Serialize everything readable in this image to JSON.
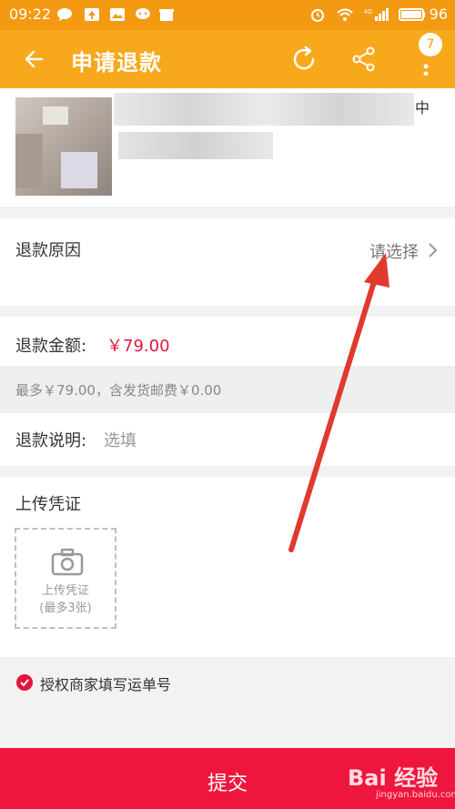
{
  "status_bar": {
    "time": "09:22",
    "battery": "96",
    "network": "4G"
  },
  "app_bar": {
    "title": "申请退款",
    "badge_count": "7"
  },
  "product": {
    "tail_text": "中"
  },
  "refund_reason": {
    "label": "退款原因",
    "value": "请选择"
  },
  "refund_amount": {
    "label": "退款金额:",
    "value": "￥79.00",
    "note": "最多￥79.00，含发货邮费￥0.00"
  },
  "refund_note": {
    "label": "退款说明:",
    "placeholder": "选填"
  },
  "upload": {
    "title": "上传凭证",
    "box_label": "上传凭证",
    "box_limit": "(最多3张)"
  },
  "authorize": {
    "label": "授权商家填写运单号",
    "checked": true
  },
  "submit": {
    "label": "提交"
  },
  "watermark": {
    "text": "Bai 经验",
    "sub": "jingyan.baidu.com"
  },
  "colors": {
    "header": "#f7a81b",
    "accent_red": "#e0173a",
    "submit_bg": "#ef163d"
  }
}
